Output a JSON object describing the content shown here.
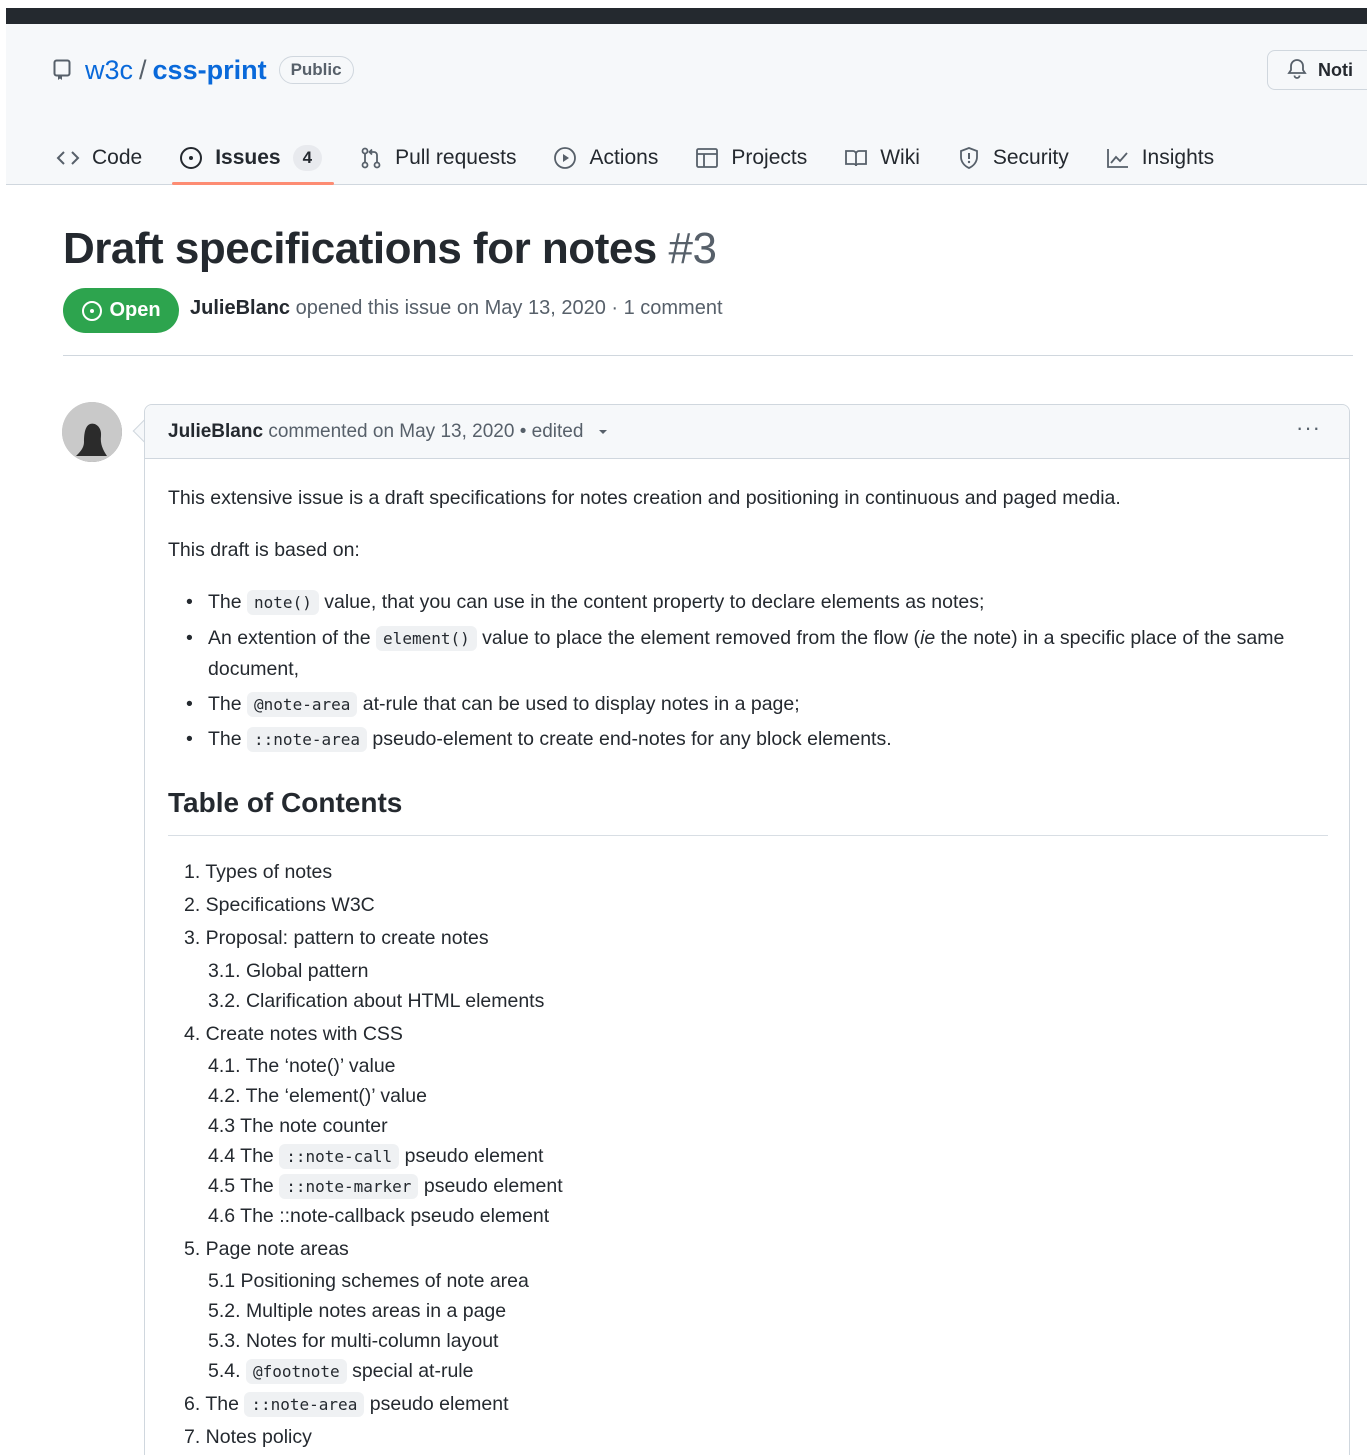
{
  "repo": {
    "owner": "w3c",
    "separator": "/",
    "name": "css-print",
    "visibility": "Public",
    "notify_label": "Noti"
  },
  "tabs": [
    {
      "label": "Code",
      "icon": "code-icon"
    },
    {
      "label": "Issues",
      "icon": "issue-opened-icon",
      "counter": "4",
      "active": true
    },
    {
      "label": "Pull requests",
      "icon": "git-pull-request-icon"
    },
    {
      "label": "Actions",
      "icon": "play-icon"
    },
    {
      "label": "Projects",
      "icon": "table-icon"
    },
    {
      "label": "Wiki",
      "icon": "book-icon"
    },
    {
      "label": "Security",
      "icon": "shield-icon"
    },
    {
      "label": "Insights",
      "icon": "graph-icon"
    }
  ],
  "issue": {
    "title": "Draft specifications for notes",
    "number": "#3",
    "state": "Open",
    "author": "JulieBlanc",
    "meta_text": "opened this issue on May 13, 2020 · 1 comment"
  },
  "comment": {
    "author": "JulieBlanc",
    "meta_text": "commented on May 13, 2020 • edited",
    "more_label": "···",
    "intro": "This extensive issue is a draft specifications for notes creation and positioning in continuous and paged media.",
    "based_on": "This draft is based on:",
    "bullets": {
      "b1_pre": "The",
      "b1_code": "note()",
      "b1_post": "value, that you can use in the content property to declare elements as notes;",
      "b2_pre": "An extention of the",
      "b2_code": "element()",
      "b2_mid": "value to place the element removed from the flow (",
      "b2_em": "ie",
      "b2_post": "the note) in a specific place of the same document,",
      "b3_pre": "The",
      "b3_code": "@note-area",
      "b3_post": "at-rule that can be used to display notes in a page;",
      "b4_pre": "The",
      "b4_code": "::note-area",
      "b4_post": "pseudo-element to create end-notes for any block elements."
    },
    "toc_heading": "Table of Contents",
    "toc": {
      "i1": "1. Types of notes",
      "i2": "2. Specifications W3C",
      "i3": "3. Proposal: pattern to create notes",
      "i3_1": "3.1. Global pattern",
      "i3_2": "3.2. Clarification about HTML elements",
      "i4": "4. Create notes with CSS",
      "i4_1": "4.1. The ‘note()’ value",
      "i4_2": "4.2. The ‘element()’ value",
      "i4_3": "4.3 The note counter",
      "i4_4_pre": "4.4 The",
      "i4_4_code": "::note-call",
      "i4_4_post": "pseudo element",
      "i4_5_pre": "4.5 The",
      "i4_5_code": "::note-marker",
      "i4_5_post": "pseudo element",
      "i4_6": "4.6 The ::note-callback pseudo element",
      "i5": "5. Page note areas",
      "i5_1": "5.1 Positioning schemes of note area",
      "i5_2": "5.2. Multiple notes areas in a page",
      "i5_3": "5.3. Notes for multi-column layout",
      "i5_4_pre": "5.4.",
      "i5_4_code": "@footnote",
      "i5_4_post": "special at-rule",
      "i6_pre": "6. The",
      "i6_code": "::note-area",
      "i6_post": "pseudo element",
      "i7": "7. Notes policy"
    }
  },
  "colors": {
    "link": "#0969da",
    "open_green": "#2da44e",
    "tab_underline": "#fd8c73",
    "header_bg": "#f6f8fa"
  }
}
